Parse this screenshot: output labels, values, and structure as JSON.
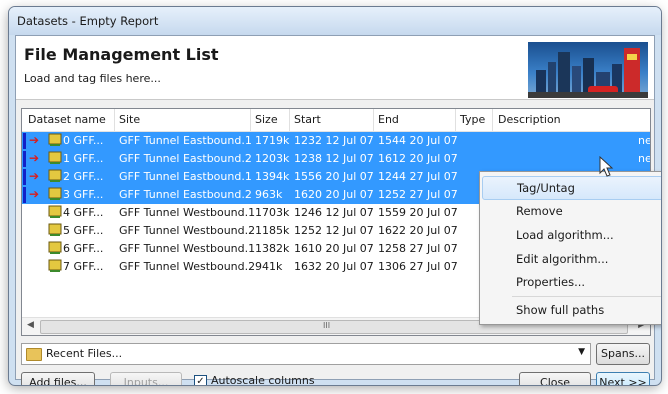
{
  "window": {
    "title": "Datasets - Empty Report"
  },
  "header": {
    "title": "File Management List",
    "subtitle": "Load and tag files here..."
  },
  "columns": [
    "Dataset name",
    "Site",
    "Size",
    "Start",
    "End",
    "Type",
    "Description"
  ],
  "rows": [
    {
      "name": "0 GFF...",
      "site": "GFF Tunnel Eastbound.1",
      "size": "1719k",
      "start": "1232 12 Jul 07",
      "end": "1544 20 Jul 07",
      "selected": true,
      "tagged": true
    },
    {
      "name": "1 GFF...",
      "site": "GFF Tunnel Eastbound.2",
      "size": "1203k",
      "start": "1238 12 Jul 07",
      "end": "1612 20 Jul 07",
      "selected": true,
      "tagged": true
    },
    {
      "name": "2 GFF...",
      "site": "GFF Tunnel Eastbound.1",
      "size": "1394k",
      "start": "1556 20 Jul 07",
      "end": "1244 27 Jul 07",
      "selected": true,
      "tagged": true
    },
    {
      "name": "3 GFF...",
      "site": "GFF Tunnel Eastbound.2",
      "size": "963k",
      "start": "1620 20 Jul 07",
      "end": "1252 27 Jul 07",
      "selected": true,
      "tagged": true
    },
    {
      "name": "4 GFF...",
      "site": "GFF Tunnel Westbound.1",
      "size": "1703k",
      "start": "1246 12 Jul 07",
      "end": "1559 20 Jul 07",
      "selected": false,
      "tagged": false
    },
    {
      "name": "5 GFF...",
      "site": "GFF Tunnel Westbound.2",
      "size": "1185k",
      "start": "1252 12 Jul 07",
      "end": "1622 20 Jul 07",
      "selected": false,
      "tagged": false
    },
    {
      "name": "6 GFF...",
      "site": "GFF Tunnel Westbound.1",
      "size": "1382k",
      "start": "1610 20 Jul 07",
      "end": "1258 27 Jul 07",
      "selected": false,
      "tagged": false
    },
    {
      "name": "7 GFF...",
      "site": "GFF Tunnel Westbound.2",
      "size": "941k",
      "start": "1632 20 Jul 07",
      "end": "1306 27 Jul 07",
      "selected": false,
      "tagged": false
    }
  ],
  "row_desc_fragment": "ne",
  "context_menu": [
    "Tag/Untag",
    "Remove",
    "Load algorithm...",
    "Edit algorithm...",
    "Properties...",
    "Show full paths"
  ],
  "scroll_grip": "III",
  "bottom": {
    "recent": "Recent Files...",
    "spans": "Spans...",
    "add_files": "Add files...",
    "inputs": "Inputs...",
    "autoscale": "Autoscale columns",
    "autoscale_checked": true,
    "close": "Close",
    "next": "Next >>"
  },
  "colors": {
    "selection": "#3399ff",
    "tag_flag": "#1020c8",
    "tag_arrow": "#d81e1e"
  }
}
